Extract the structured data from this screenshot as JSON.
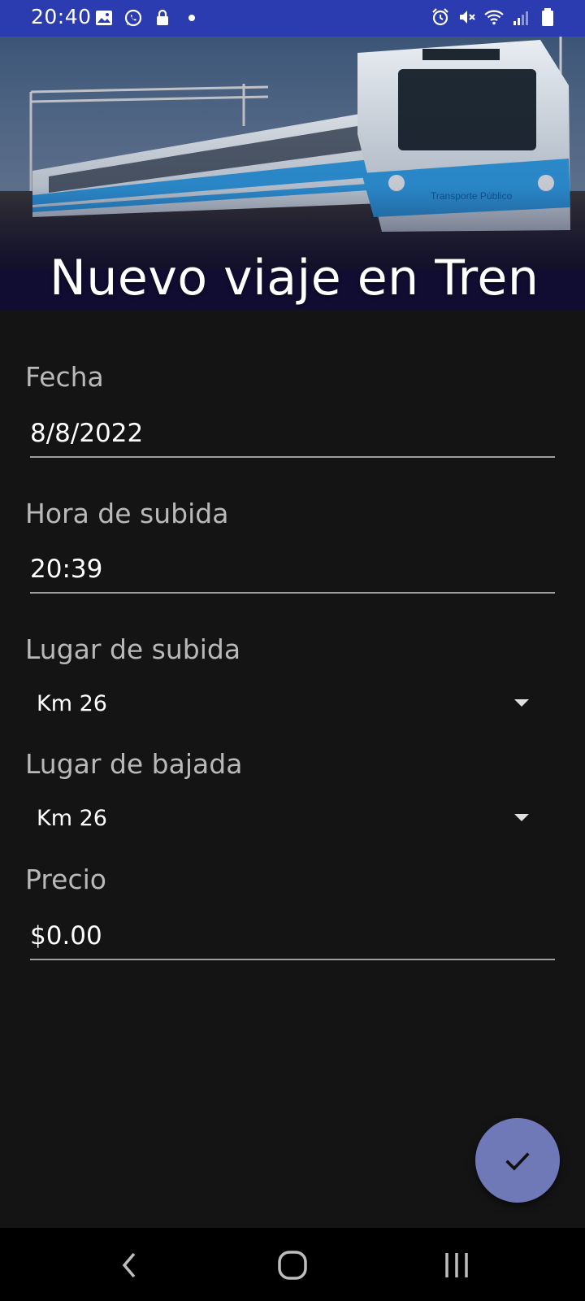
{
  "status_bar": {
    "time": "20:40",
    "left_icons": [
      "image-icon",
      "whatsapp-icon",
      "lock-icon",
      "dot-icon"
    ],
    "right_icons": [
      "alarm-icon",
      "mute-icon",
      "wifi-icon",
      "signal-icon",
      "battery-icon"
    ],
    "color": "#2b3bb0"
  },
  "header": {
    "title": "Nuevo viaje en Tren",
    "image": "train-photo"
  },
  "form": {
    "fecha": {
      "label": "Fecha",
      "value": "8/8/2022"
    },
    "hora_subida": {
      "label": "Hora de subida",
      "value": "20:39"
    },
    "lugar_subida": {
      "label": "Lugar de subida",
      "value": "Km 26"
    },
    "lugar_bajada": {
      "label": "Lugar de bajada",
      "value": "Km 26"
    },
    "precio": {
      "label": "Precio",
      "value": "$0.00"
    }
  },
  "fab": {
    "icon": "check-icon",
    "color": "#6f79b8"
  },
  "nav_bar": {
    "buttons": [
      "back-icon",
      "home-icon",
      "recents-icon"
    ]
  }
}
